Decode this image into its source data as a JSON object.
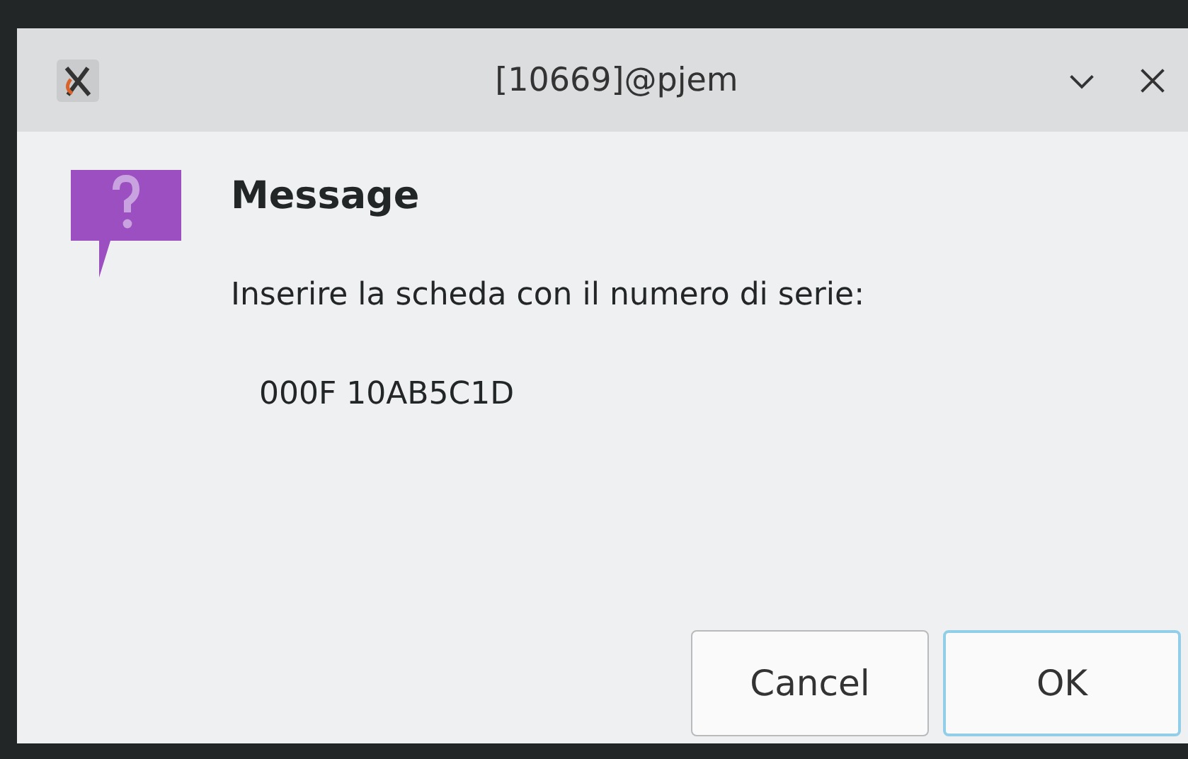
{
  "window": {
    "title": "[10669]@pjem"
  },
  "message": {
    "heading": "Message",
    "text": "Inserire la scheda con il numero di serie:",
    "serial": "000F 10AB5C1D"
  },
  "buttons": [
    {
      "label": "Cancel",
      "default": false
    },
    {
      "label": "OK",
      "default": true
    }
  ]
}
